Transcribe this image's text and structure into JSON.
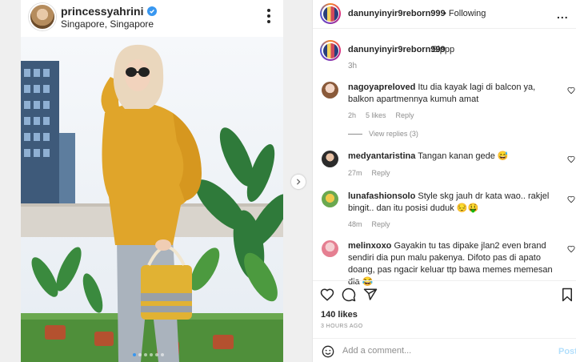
{
  "post_header": {
    "username": "princessyahrini",
    "location": "Singapore, Singapore"
  },
  "side_header": {
    "username": "danunyinyir9reborn999",
    "separator": "•",
    "follow_status": "Following",
    "more": "..."
  },
  "caption": {
    "username": "danunyinyir9reborn999",
    "text": "Sippp",
    "time": "3h"
  },
  "comments": [
    {
      "username": "nagoyapreloved",
      "text": "Itu dia kayak lagi di balcon ya, balkon apartmennya kumuh amat",
      "time": "2h",
      "likes": "5 likes",
      "reply": "Reply",
      "view_replies": "View replies (3)"
    },
    {
      "username": "medyantaristina",
      "text": "Tangan kanan gede 😅",
      "time": "27m",
      "reply": "Reply"
    },
    {
      "username": "lunafashionsolo",
      "text": "Style skg jauh dr kata wao.. rakjel bingit.. dan itu posisi duduk 😔🤑",
      "time": "48m",
      "reply": "Reply"
    },
    {
      "username": "melinxoxo",
      "text": "Gayakin tu tas dipake jlan2 even brand sendiri dia pun malu pakenya. Difoto pas di apato doang, pas ngacir keluar ttp bawa memes memesan dia 😂"
    }
  ],
  "stats": {
    "likes": "140 likes",
    "posted": "3 HOURS AGO"
  },
  "comment_box": {
    "placeholder": "Add a comment...",
    "post_label": "Post"
  },
  "icons": {
    "like": "heart-icon",
    "comment": "comment-icon",
    "share": "share-icon",
    "save": "bookmark-icon",
    "emoji": "emoji-icon",
    "next": "chevron-right-icon"
  },
  "colors": {
    "link": "#3897f0",
    "muted": "#8e8e8e",
    "post_disabled": "#b2dffc"
  }
}
